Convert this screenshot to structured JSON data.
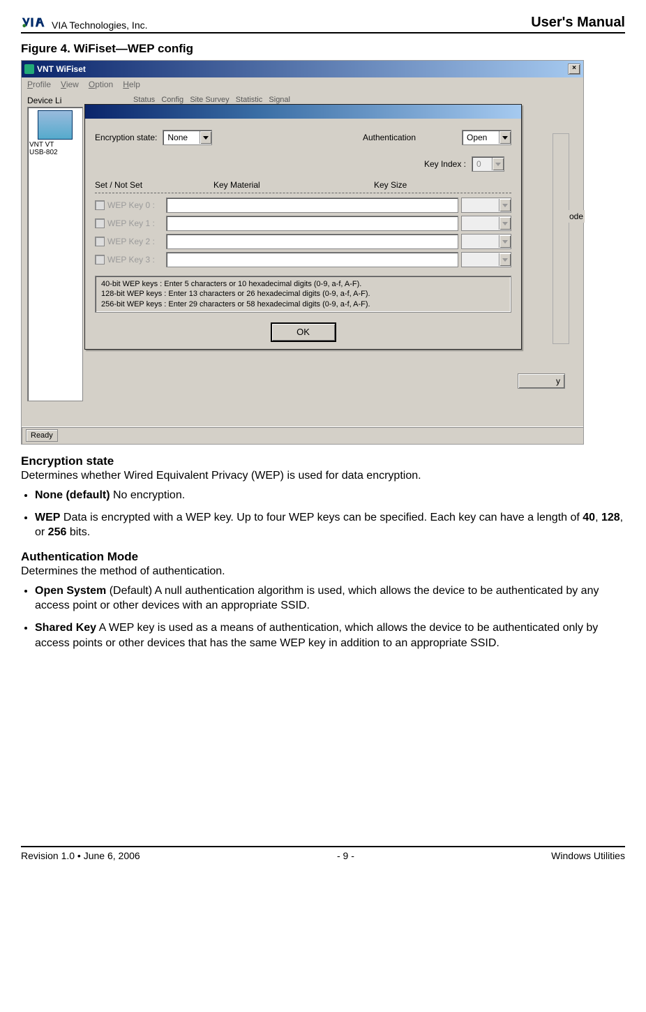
{
  "header": {
    "company": "VIA Technologies, Inc.",
    "manual": "User's Manual"
  },
  "figure_title": "Figure 4. WiFiset—WEP config",
  "main_window": {
    "title": "VNT WiFiset",
    "menus": {
      "m1": "Profile",
      "m2": "View",
      "m3": "Option",
      "m4": "Help"
    },
    "device_list_label": "Device Li",
    "device_name_l1": "VNT VT",
    "device_name_l2": "USB-802",
    "status_text": "Ready",
    "partial_ode": "ode",
    "partial_y": "y"
  },
  "dialog": {
    "enc_label": "Encryption state:",
    "enc_value": "None",
    "auth_label": "Authentication",
    "auth_value": "Open",
    "key_index_label": "Key Index :",
    "key_index_value": "0",
    "header_set": "Set / Not Set",
    "header_material": "Key Material",
    "header_size": "Key Size",
    "key_labels": {
      "k0": "WEP Key 0 :",
      "k1": "WEP Key 1 :",
      "k2": "WEP Key 2 :",
      "k3": "WEP Key 3 :"
    },
    "hint_l1": "  40-bit WEP keys : Enter 5 characters or  10 hexadecimal digits (0-9, a-f, A-F).",
    "hint_l2": "128-bit WEP keys : Enter 13 characters or  26 hexadecimal digits (0-9, a-f, A-F).",
    "hint_l3": "256-bit WEP keys : Enter 29 characters or  58 hexadecimal digits (0-9, a-f, A-F).",
    "ok_label": "OK"
  },
  "body": {
    "enc_heading": "Encryption state",
    "enc_desc": "Determines whether Wired Equivalent Privacy (WEP) is used for data encryption.",
    "none_strong": "None (default)",
    "none_rest": "   No encryption.",
    "wep_strong": "WEP",
    "wep_rest_a": "   Data is encrypted with a WEP key. Up to four WEP keys can be specified. Each key can have a length of ",
    "wep_40": "40",
    "wep_128": "128",
    "wep_256": "256",
    "wep_bits": " bits.",
    "auth_heading": "Authentication Mode",
    "auth_desc": "Determines the method of authentication.",
    "open_strong": "Open System",
    "open_paren": " (Default)",
    "open_rest": "   A null authentication algorithm is used, which allows the device to be authenticated by any access point or other devices with an appropriate SSID.",
    "shared_strong": "Shared Key",
    "shared_rest": "   A WEP key is used as a means of authentication, which allows the device to be authenticated only by access points or other devices that has the same WEP key in addition to an appropriate SSID."
  },
  "footer": {
    "left": "Revision 1.0 • June 6, 2006",
    "center": "- 9 -",
    "right": "Windows Utilities"
  }
}
